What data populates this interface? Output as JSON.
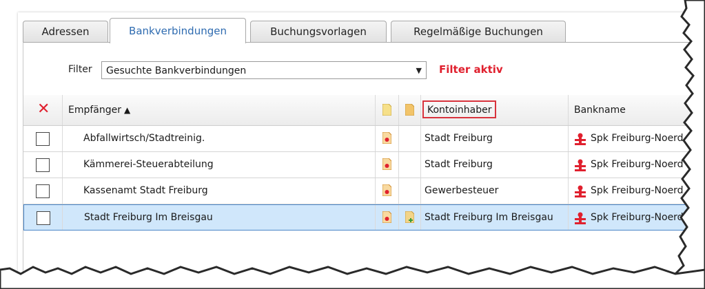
{
  "tabs": [
    {
      "label": "Adressen"
    },
    {
      "label": "Bankverbindungen"
    },
    {
      "label": "Buchungsvorlagen"
    },
    {
      "label": "Regelmäßige Buchungen"
    }
  ],
  "active_tab": "Bankverbindungen",
  "filter": {
    "label": "Filter",
    "selected": "Gesuchte Bankverbindungen",
    "status": "Filter aktiv",
    "status_color": "#e0202e"
  },
  "table": {
    "headers": {
      "empfaenger": "Empfänger",
      "empfaenger_sort": "▲",
      "kontoinhaber": "Kontoinhaber",
      "bankname": "Bankname"
    },
    "rows": [
      {
        "empfaenger": "Abfallwirtsch/Stadtreinig.",
        "kontoinhaber": "Stadt Freiburg",
        "bankname": "Spk Freiburg-Noerd",
        "selected": false
      },
      {
        "empfaenger": "Kämmerei-Steuerabteilung",
        "kontoinhaber": "Stadt Freiburg",
        "bankname": "Spk Freiburg-Noerd",
        "selected": false
      },
      {
        "empfaenger": "Kassenamt Stadt Freiburg",
        "kontoinhaber": "Gewerbesteuer",
        "bankname": "Spk Freiburg-Noerd",
        "selected": false
      },
      {
        "empfaenger": "Stadt Freiburg Im Breisgau",
        "kontoinhaber": "Stadt Freiburg Im Breisgau",
        "bankname": "Spk Freiburg-Noerd",
        "selected": true
      }
    ]
  },
  "colors": {
    "accent_tab_text": "#2e6bb0",
    "selection_bg": "#d0e7fb",
    "highlight_box": "#d8323c"
  },
  "icons": {
    "delete": "red-x-icon",
    "document_orange": "document-orange-icon",
    "document_folder": "document-folder-icon",
    "sparkasse": "sparkasse-logo-icon"
  }
}
